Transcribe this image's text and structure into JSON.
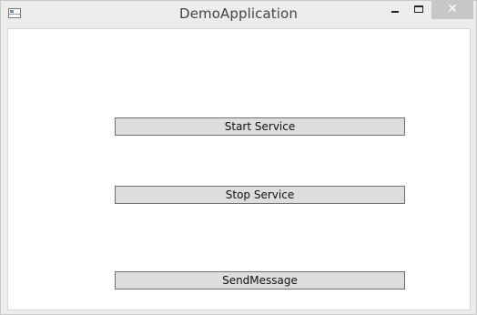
{
  "window": {
    "title": "DemoApplication",
    "icon": "app-window-icon",
    "controls": {
      "minimize_icon": "minimize-icon",
      "maximize_icon": "maximize-icon",
      "close_label": "✕"
    }
  },
  "buttons": {
    "start_service": "Start Service",
    "stop_service": "Stop Service",
    "send_message": "SendMessage"
  },
  "colors": {
    "button_face": "#dddddd",
    "button_border": "#707070",
    "close_button_bg": "#c7c7c7",
    "window_chrome": "#ececec"
  }
}
